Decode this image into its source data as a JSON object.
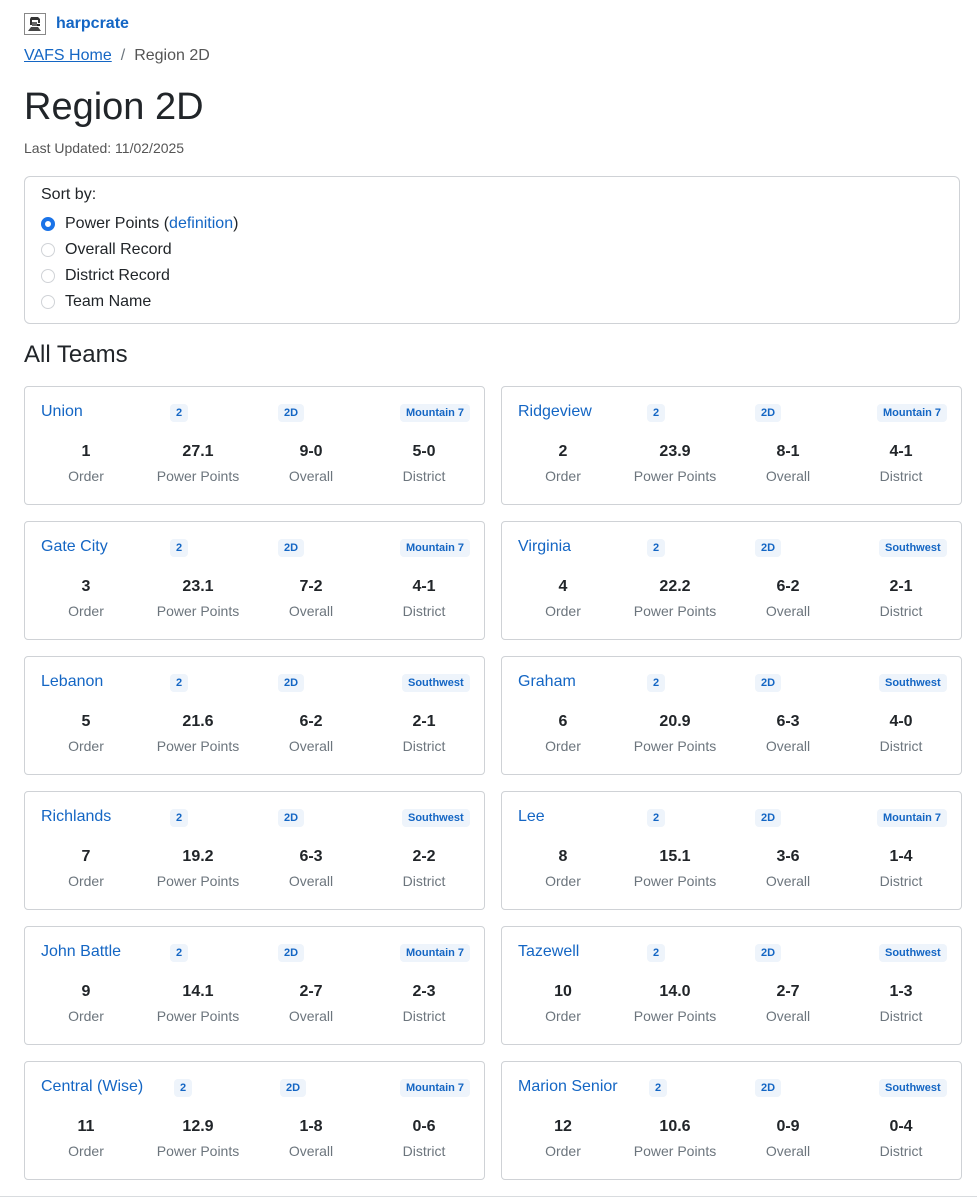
{
  "brand": {
    "name": "harpcrate",
    "icon": "pixel-avatar-icon"
  },
  "breadcrumb": {
    "home": "VAFS Home",
    "separator": "/",
    "current": "Region 2D"
  },
  "page": {
    "title": "Region 2D",
    "last_updated": "Last Updated: 11/02/2025"
  },
  "sort": {
    "label": "Sort by:",
    "power_points": {
      "label": "Power Points (",
      "link": "definition",
      "suffix": ")"
    },
    "overall": "Overall Record",
    "district": "District Record",
    "team": "Team Name",
    "selected": "Power Points"
  },
  "section_title": "All Teams",
  "stat_labels": {
    "order": "Order",
    "power": "Power Points",
    "overall": "Overall",
    "district": "District"
  },
  "teams": [
    {
      "name": "Union",
      "class": "2",
      "region": "2D",
      "district_name": "Mountain 7",
      "order": "1",
      "power": "27.1",
      "overall": "9-0",
      "district": "5-0"
    },
    {
      "name": "Ridgeview",
      "class": "2",
      "region": "2D",
      "district_name": "Mountain 7",
      "order": "2",
      "power": "23.9",
      "overall": "8-1",
      "district": "4-1"
    },
    {
      "name": "Gate City",
      "class": "2",
      "region": "2D",
      "district_name": "Mountain 7",
      "order": "3",
      "power": "23.1",
      "overall": "7-2",
      "district": "4-1"
    },
    {
      "name": "Virginia",
      "class": "2",
      "region": "2D",
      "district_name": "Southwest",
      "order": "4",
      "power": "22.2",
      "overall": "6-2",
      "district": "2-1"
    },
    {
      "name": "Lebanon",
      "class": "2",
      "region": "2D",
      "district_name": "Southwest",
      "order": "5",
      "power": "21.6",
      "overall": "6-2",
      "district": "2-1"
    },
    {
      "name": "Graham",
      "class": "2",
      "region": "2D",
      "district_name": "Southwest",
      "order": "6",
      "power": "20.9",
      "overall": "6-3",
      "district": "4-0"
    },
    {
      "name": "Richlands",
      "class": "2",
      "region": "2D",
      "district_name": "Southwest",
      "order": "7",
      "power": "19.2",
      "overall": "6-3",
      "district": "2-2"
    },
    {
      "name": "Lee",
      "class": "2",
      "region": "2D",
      "district_name": "Mountain 7",
      "order": "8",
      "power": "15.1",
      "overall": "3-6",
      "district": "1-4"
    },
    {
      "name": "John Battle",
      "class": "2",
      "region": "2D",
      "district_name": "Mountain 7",
      "order": "9",
      "power": "14.1",
      "overall": "2-7",
      "district": "2-3"
    },
    {
      "name": "Tazewell",
      "class": "2",
      "region": "2D",
      "district_name": "Southwest",
      "order": "10",
      "power": "14.0",
      "overall": "2-7",
      "district": "1-3"
    },
    {
      "name": "Central (Wise)",
      "class": "2",
      "region": "2D",
      "district_name": "Mountain 7",
      "order": "11",
      "power": "12.9",
      "overall": "1-8",
      "district": "0-6"
    },
    {
      "name": "Marion Senior",
      "class": "2",
      "region": "2D",
      "district_name": "Southwest",
      "order": "12",
      "power": "10.6",
      "overall": "0-9",
      "district": "0-4"
    }
  ],
  "colors": {
    "link": "#1466c4",
    "radio_selected": "#1a73e8",
    "chip_bg": "#eef4fb",
    "border": "#cfd2d6"
  }
}
